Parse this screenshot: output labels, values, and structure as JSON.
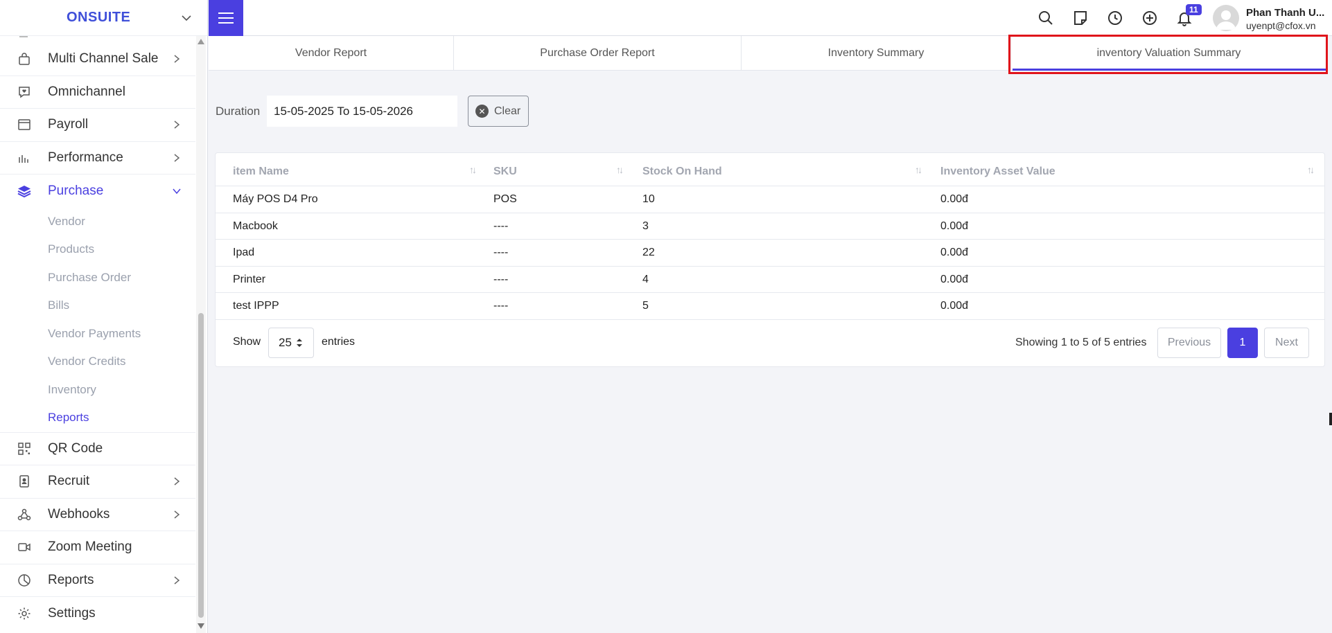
{
  "brand": "ONSUITE",
  "sidebar": {
    "items": [
      {
        "label": "Multi Channel Sale",
        "icon": "shopping-bag-icon",
        "has_arrow": true
      },
      {
        "label": "Omnichannel",
        "icon": "chat-heart-icon",
        "has_arrow": false
      },
      {
        "label": "Payroll",
        "icon": "browser-window-icon",
        "has_arrow": true
      },
      {
        "label": "Performance",
        "icon": "bar-chart-icon",
        "has_arrow": true
      },
      {
        "label": "Purchase",
        "icon": "layers-icon",
        "has_arrow": true,
        "expanded": true
      }
    ],
    "purchase_sub": [
      "Vendor",
      "Products",
      "Purchase Order",
      "Bills",
      "Vendor Payments",
      "Vendor Credits",
      "Inventory",
      "Reports"
    ],
    "items_after": [
      {
        "label": "QR Code",
        "icon": "qr-code-icon",
        "has_arrow": false
      },
      {
        "label": "Recruit",
        "icon": "id-badge-icon",
        "has_arrow": true
      },
      {
        "label": "Webhooks",
        "icon": "webhook-icon",
        "has_arrow": true
      },
      {
        "label": "Zoom Meeting",
        "icon": "video-camera-icon",
        "has_arrow": false
      },
      {
        "label": "Reports",
        "icon": "pie-chart-icon",
        "has_arrow": true
      },
      {
        "label": "Settings",
        "icon": "gear-icon",
        "has_arrow": false
      }
    ]
  },
  "header": {
    "notification_count": "11",
    "user_name": "Phan Thanh U...",
    "user_email": "uyenpt@cfox.vn"
  },
  "tabs": [
    "Vendor Report",
    "Purchase Order Report",
    "Inventory Summary",
    "inventory Valuation Summary"
  ],
  "filter": {
    "duration_label": "Duration",
    "duration_value": "15-05-2025 To 15-05-2026",
    "clear_label": "Clear"
  },
  "table": {
    "columns": [
      "item Name",
      "SKU",
      "Stock On Hand",
      "Inventory Asset Value"
    ],
    "rows": [
      [
        "Máy POS D4 Pro",
        "POS",
        "10",
        "0.00đ"
      ],
      [
        "Macbook",
        "----",
        "3",
        "0.00đ"
      ],
      [
        "Ipad",
        "----",
        "22",
        "0.00đ"
      ],
      [
        "Printer",
        "----",
        "4",
        "0.00đ"
      ],
      [
        "test IPPP",
        "----",
        "5",
        "0.00đ"
      ]
    ]
  },
  "pagination": {
    "show_label": "Show",
    "page_size": "25",
    "entries_label": "entries",
    "info": "Showing 1 to 5 of 5 entries",
    "previous": "Previous",
    "current_page": "1",
    "next": "Next"
  },
  "colors": {
    "accent": "#4a3fe0",
    "highlight": "#e0141b"
  }
}
